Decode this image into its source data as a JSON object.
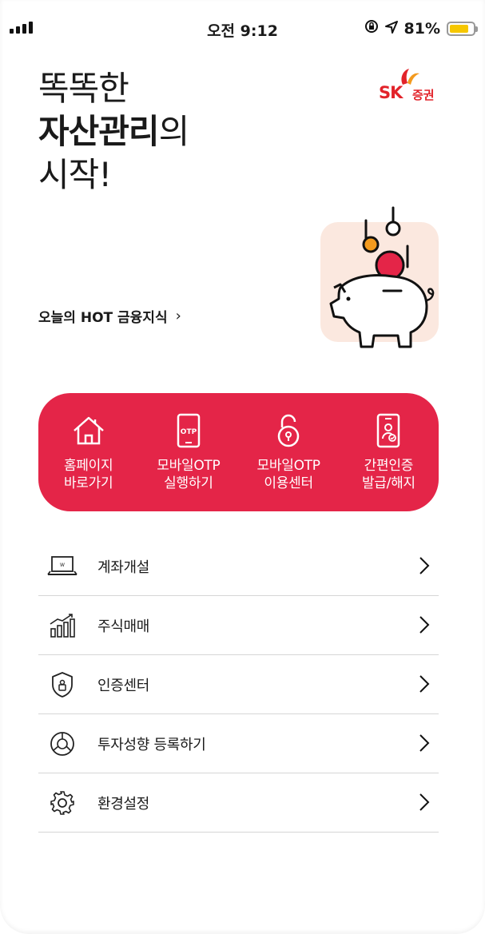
{
  "status_bar": {
    "time": "오전 9:12",
    "battery": "81%",
    "battery_level": 0.81,
    "icons": [
      "signal-icon",
      "rotation-lock-icon",
      "location-arrow-icon",
      "battery-icon"
    ]
  },
  "hero": {
    "title_line1": "똑똑한",
    "title_line2_bold": "자산관리",
    "title_line2_rest": "의",
    "title_line3": "시작!"
  },
  "logo": {
    "sk": "SK",
    "company": "증권"
  },
  "hot_link": {
    "label": "오늘의 HOT 금융지식",
    "chevron": "›"
  },
  "quick_menu": [
    {
      "line1": "홈페이지",
      "line2": "바로가기",
      "icon": "home-icon"
    },
    {
      "line1": "모바일OTP",
      "line2": "실행하기",
      "icon": "otp-phone-icon",
      "icon_text": "OTP"
    },
    {
      "line1": "모바일OTP",
      "line2": "이용센터",
      "icon": "lock-icon"
    },
    {
      "line1": "간편인증",
      "line2": "발급/해지",
      "icon": "certificate-phone-icon"
    }
  ],
  "menu_list": [
    {
      "label": "계좌개설",
      "icon": "laptop-icon"
    },
    {
      "label": "주식매매",
      "icon": "stock-chart-icon"
    },
    {
      "label": "인증센터",
      "icon": "shield-icon"
    },
    {
      "label": "투자성향 등록하기",
      "icon": "pie-chart-icon"
    },
    {
      "label": "환경설정",
      "icon": "gear-icon"
    }
  ],
  "colors": {
    "brand_red": "#e42548",
    "logo_red": "#e2232a",
    "logo_orange": "#f39a1e",
    "pig_card_bg": "#fbe8df",
    "battery_yellow": "#f6c700"
  }
}
